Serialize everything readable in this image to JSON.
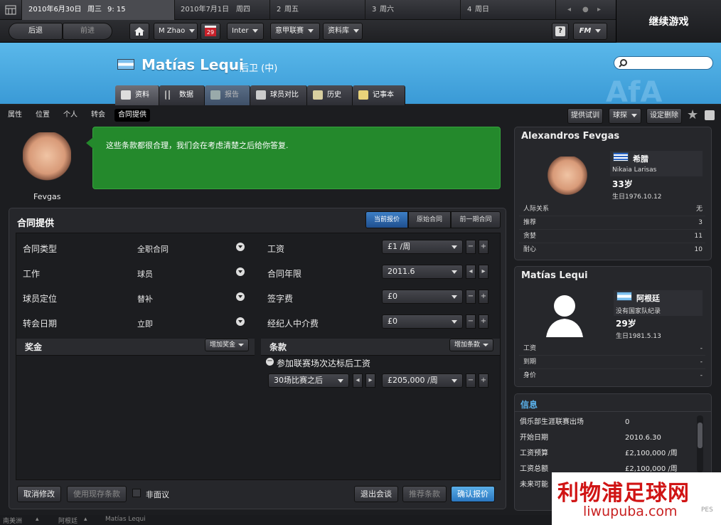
{
  "datebar": {
    "current_date": "2010年6月30日",
    "current_weekday": "周三",
    "current_time": "9: 15",
    "days": [
      {
        "date": "2010年7月1日",
        "weekday": "周四"
      },
      {
        "date": "2",
        "weekday": "周五"
      },
      {
        "date": "3",
        "weekday": "周六"
      },
      {
        "date": "4",
        "weekday": "周日"
      }
    ]
  },
  "continue_label": "继续游戏",
  "toolbar": {
    "back": "后退",
    "forward": "前进",
    "user": "M Zhao",
    "calendar_day": "29",
    "club": "Inter",
    "league": "意甲联赛",
    "database": "资料库",
    "help": "?",
    "fm": "FM"
  },
  "player": {
    "name": "Matías Lequi",
    "position": "后卫 (中)"
  },
  "tabs": [
    "资料",
    "数据",
    "报告",
    "球员对比",
    "历史",
    "记事本"
  ],
  "subnav": [
    "属性",
    "位置",
    "个人",
    "转会",
    "合同提供"
  ],
  "actions": {
    "trial": "提供试训",
    "scout": "球探",
    "set_delete": "设定删除"
  },
  "agent": {
    "name": "Fevgas",
    "message": "这些条款都很合理，我们会在考虑清楚之后给你答复."
  },
  "contract": {
    "title": "合同提供",
    "segments": [
      "当前报价",
      "原始合同",
      "前一期合同"
    ],
    "left_rows": [
      {
        "label": "合同类型",
        "value": "全职合同"
      },
      {
        "label": "工作",
        "value": "球员"
      },
      {
        "label": "球员定位",
        "value": "替补"
      },
      {
        "label": "转会日期",
        "value": "立即"
      }
    ],
    "right_rows": [
      {
        "label": "工资",
        "value": "£1 /周"
      },
      {
        "label": "合同年限",
        "value": "2011.6"
      },
      {
        "label": "签字费",
        "value": "£0"
      },
      {
        "label": "经纪人中介费",
        "value": "£0"
      }
    ],
    "bonus_label": "奖金",
    "add_bonus": "增加奖金",
    "clauses_label": "条款",
    "add_clause": "增加条款",
    "clause_name": "参加联赛场次达标后工资",
    "clause_condition": "30场比赛之后",
    "clause_value": "£205,000 /周",
    "buttons": {
      "cancel": "取消修改",
      "use_existing": "使用现存条款",
      "non_negotiable": "非面议",
      "leave": "退出会谈",
      "recommend": "推荐条款",
      "confirm": "确认报价"
    }
  },
  "agent_card": {
    "name": "Alexandros Fevgas",
    "nation": "希腊",
    "club": "Nikaia Larisas",
    "age": "33岁",
    "birth": "生日1976.10.12",
    "stats": [
      {
        "label": "人际关系",
        "value": "无"
      },
      {
        "label": "推荐",
        "value": "3"
      },
      {
        "label": "贪婪",
        "value": "11"
      },
      {
        "label": "耐心",
        "value": "10"
      }
    ]
  },
  "player_card": {
    "name": "Matías Lequi",
    "nation": "阿根廷",
    "intl": "没有国家队纪录",
    "age": "29岁",
    "birth": "生日1981.5.13",
    "stats": [
      {
        "label": "工资",
        "value": "-"
      },
      {
        "label": "到期",
        "value": "-"
      },
      {
        "label": "身价",
        "value": "-"
      }
    ]
  },
  "info": {
    "title": "信息",
    "rows": [
      {
        "label": "俱乐部生涯联赛出场",
        "value": "0"
      },
      {
        "label": "开始日期",
        "value": "2010.6.30"
      },
      {
        "label": "工资预算",
        "value": "£2,100,000 /周"
      },
      {
        "label": "工资总额",
        "value": "£2,100,000 /周"
      },
      {
        "label": "未来可能",
        "value": ""
      }
    ]
  },
  "footer": [
    "南美洲",
    "阿根廷",
    "Matías Lequi"
  ],
  "watermark": {
    "line1": "利物浦足球网",
    "line2": "liwupuba.com",
    "badge": "PES"
  },
  "colors": {
    "header_blue": "#4aa9e2",
    "bubble_green": "#24892c",
    "confirm_blue": "#3a8ad4"
  }
}
